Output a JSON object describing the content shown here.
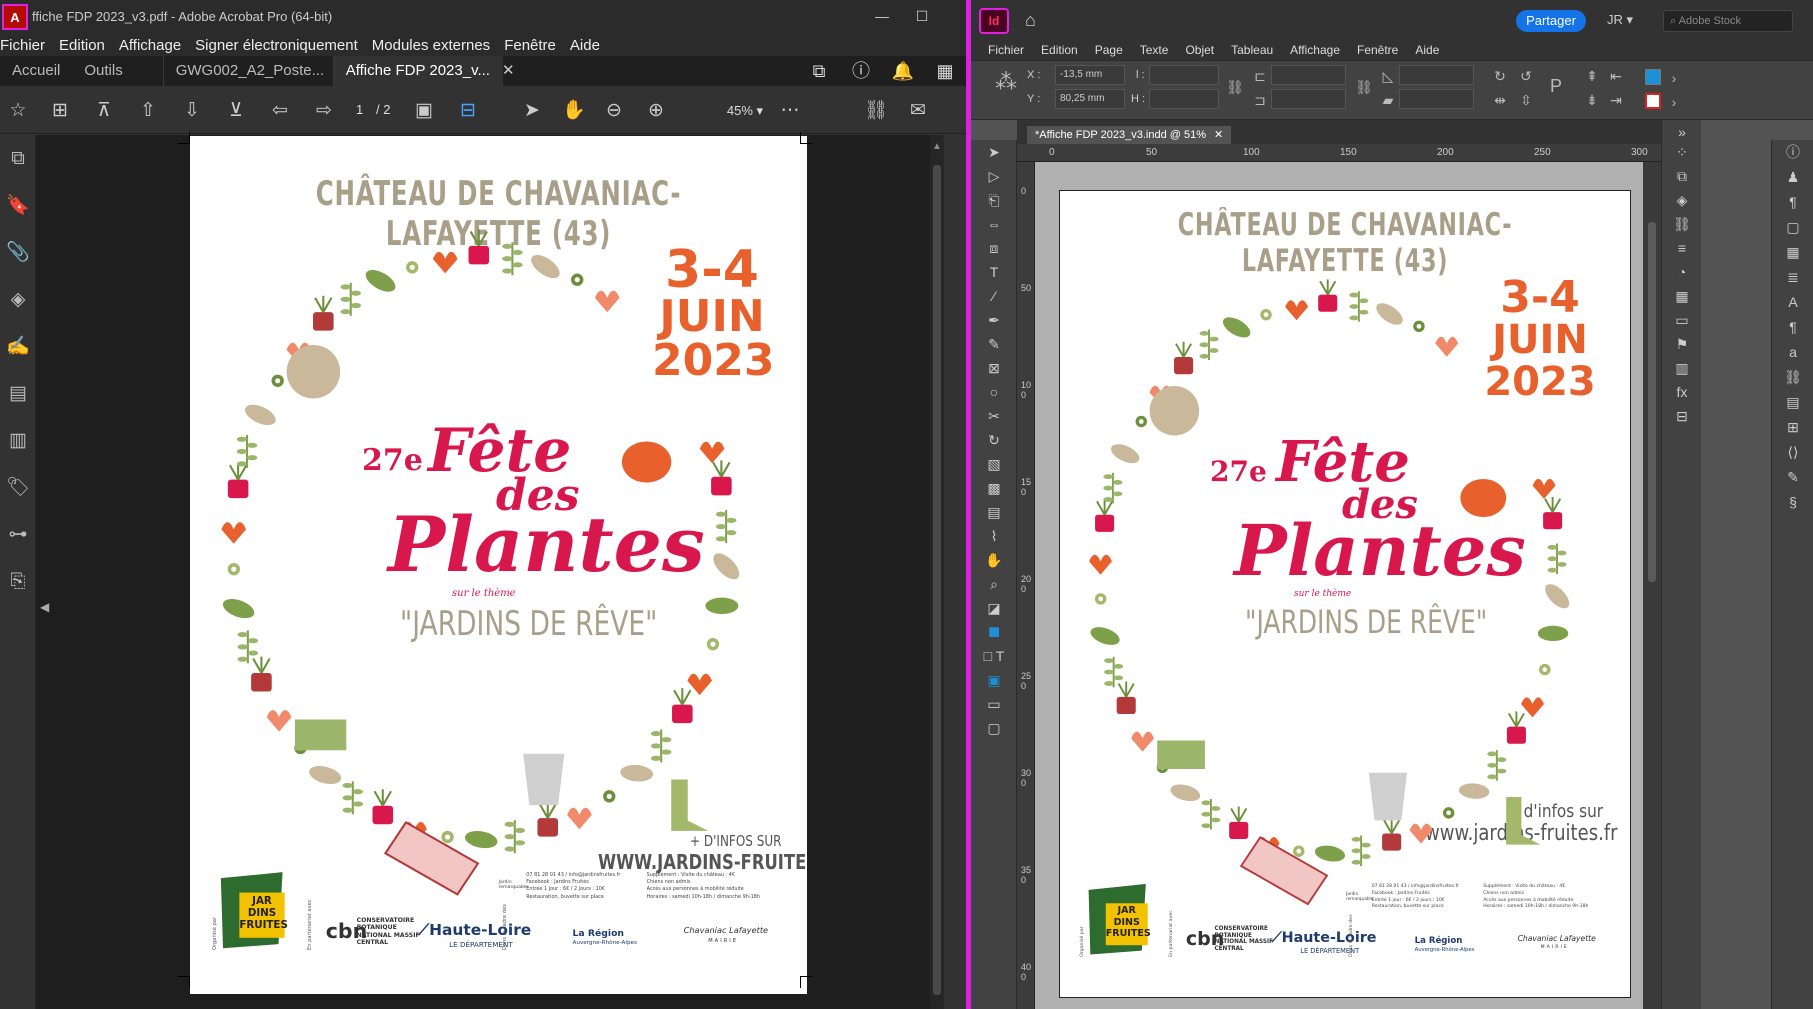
{
  "acrobat": {
    "window_title": "ffiche FDP 2023_v3.pdf - Adobe Acrobat Pro (64-bit)",
    "menu": [
      "Fichier",
      "Edition",
      "Affichage",
      "Signer électroniquement",
      "Modules externes",
      "Fenêtre",
      "Aide"
    ],
    "tabs": {
      "home": "Accueil",
      "tools": "Outils",
      "doc1": "GWG002_A2_Poste...",
      "doc2": "Affiche FDP 2023_v..."
    },
    "page_current": "1",
    "page_total": "/ 2",
    "zoom": "45%"
  },
  "indesign": {
    "share_label": "Partager",
    "user": "JR",
    "stock_placeholder": "Adobe Stock",
    "menu": [
      "Fichier",
      "Edition",
      "Page",
      "Texte",
      "Objet",
      "Tableau",
      "Affichage",
      "Fenêtre",
      "Aide"
    ],
    "x_label": "X :",
    "y_label": "Y :",
    "x_value": "-13,5 mm",
    "y_value": "80,25 mm",
    "w_label": "l :",
    "h_label": "H :",
    "doc_tab": "*Affiche FDP 2023_v3.indd @ 51%",
    "ruler_h": [
      "0",
      "50",
      "100",
      "150",
      "200",
      "250",
      "300"
    ],
    "ruler_v": [
      "0",
      "50",
      "100",
      "150",
      "200",
      "250",
      "300",
      "350",
      "400"
    ]
  },
  "poster": {
    "title": "CHÂTEAU DE CHAVANIAC-LAFAYETTE (43)",
    "date_days": "3-4",
    "date_month": "JUIN",
    "date_year": "2023",
    "edition": "27e",
    "fete": "Fête",
    "des": "des",
    "plantes": "Plantes",
    "sur_le_theme": "sur le thème",
    "theme": "\"JARDINS DE RÊVE\"",
    "plus_infos_acro": "+ D'INFOS SUR",
    "url_acro": "WWW.JARDINS-FRUITES.FR",
    "plus_infos_indd": "+ d'infos sur",
    "url_indd": "www.jardins-fruites.fr",
    "logo_jardins": "JAR DINS FRUITES",
    "cbn": "cbn",
    "cbn_text": "CONSERVATOIRE BOTANIQUE NATIONAL MASSIF CENTRAL",
    "haute_loire": "Haute-Loire",
    "haute_loire_sub": "LE DÉPARTEMENT",
    "la_region": "La Région",
    "region_sub": "Auvergne-Rhône-Alpes",
    "chavaniac": "Chavaniac Lafayette",
    "chavaniac_sub": "MAIRIE",
    "organise_par": "Organisé par",
    "en_partenariat": "En partenariat avec",
    "dans_le_cadre": "Dans le cadre des",
    "jardins_remarquables": "Jardin remarquable",
    "info_col1": [
      "07 81 28 01 43 / info@jardinsfruites.fr",
      "Facebook : Jardins Fruités",
      "Entrée 1 jour : 6€ / 2 jours : 10€",
      "Restauration, buvette sur place"
    ],
    "info_col2": [
      "Supplément : Visite du château : 4€",
      "Chiens non admis",
      "Accès aux personnes à mobilité réduite",
      "Horaires : samedi 10h-18h / dimanche 9h-18h"
    ]
  },
  "colors": {
    "accent_magenta": "#e020e0",
    "title_tan": "#a89f88",
    "date_orange": "#e8602c",
    "fete_pink": "#d8174d",
    "indesign_blue": "#1473e6"
  }
}
